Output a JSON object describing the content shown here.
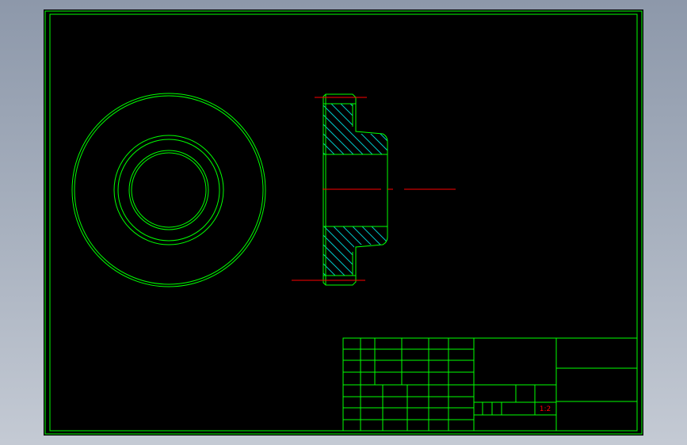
{
  "drawing": {
    "title_block": {
      "scale_text": "1:2"
    },
    "colors": {
      "sheet_background": "#000000",
      "outline": "#00ff00",
      "centerline": "#ff0000",
      "hatch": "#00c8c8",
      "text": "#ff0000",
      "backdrop_top": "#8d98aa",
      "backdrop_bottom": "#c4cad4"
    }
  }
}
